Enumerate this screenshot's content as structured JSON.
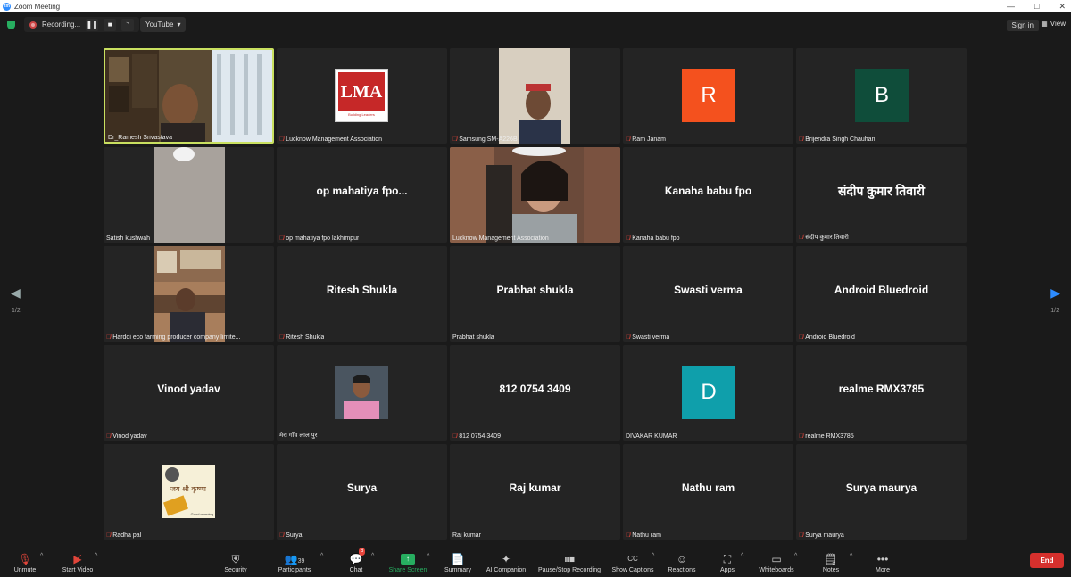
{
  "window": {
    "title": "Zoom Meeting",
    "controls": [
      "—",
      "□",
      "✕"
    ]
  },
  "topbar": {
    "recording_label": "Recording...",
    "youtube_label": "YouTube",
    "sign_in": "Sign in",
    "view": "View"
  },
  "page_indicator": "1/2",
  "tiles": [
    {
      "name": "Dr_Ramesh Srivastava",
      "center": "",
      "letter": "",
      "color": "",
      "muted": false
    },
    {
      "name": "Lucknow Management Association",
      "center": "",
      "letter": "",
      "color": "",
      "muted": true
    },
    {
      "name": "Samsung SM-A226B",
      "center": "",
      "letter": "",
      "color": "",
      "muted": true
    },
    {
      "name": "Ram Janam",
      "center": "",
      "letter": "R",
      "color": "#f4511e",
      "muted": true
    },
    {
      "name": "Brijendra Singh Chauhan",
      "center": "",
      "letter": "B",
      "color": "#0f4d3a",
      "muted": true
    },
    {
      "name": "Satish kushwah",
      "center": "",
      "letter": "",
      "color": "",
      "muted": false
    },
    {
      "name": "op mahatiya fpo lakhimpur",
      "center": "op mahatiya fpo...",
      "letter": "",
      "color": "",
      "muted": true
    },
    {
      "name": "Lucknow Management Association",
      "center": "",
      "letter": "",
      "color": "",
      "muted": false
    },
    {
      "name": "Kanaha babu fpo",
      "center": "Kanaha babu fpo",
      "letter": "",
      "color": "",
      "muted": true
    },
    {
      "name": "संदीप कुमार तिवारी",
      "center": "संदीप कुमार तिवारी",
      "letter": "",
      "color": "",
      "muted": true
    },
    {
      "name": "Hardoi eco farming producer company limite...",
      "center": "",
      "letter": "",
      "color": "",
      "muted": true
    },
    {
      "name": "Ritesh Shukla",
      "center": "Ritesh Shukla",
      "letter": "",
      "color": "",
      "muted": true
    },
    {
      "name": "Prabhat shukla",
      "center": "Prabhat shukla",
      "letter": "",
      "color": "",
      "muted": false
    },
    {
      "name": "Swasti verma",
      "center": "Swasti verma",
      "letter": "",
      "color": "",
      "muted": true
    },
    {
      "name": "Android Bluedroid",
      "center": "Android Bluedroid",
      "letter": "",
      "color": "",
      "muted": true
    },
    {
      "name": "Vinod yadav",
      "center": "Vinod yadav",
      "letter": "",
      "color": "",
      "muted": true
    },
    {
      "name": "मेरा गाँव लाल पुर",
      "center": "",
      "letter": "",
      "color": "",
      "muted": false
    },
    {
      "name": "812 0754 3409",
      "center": "812 0754 3409",
      "letter": "",
      "color": "",
      "muted": true
    },
    {
      "name": "DIVAKAR KUMAR",
      "center": "",
      "letter": "D",
      "color": "#0f9fab",
      "muted": false
    },
    {
      "name": "realme RMX3785",
      "center": "realme RMX3785",
      "letter": "",
      "color": "",
      "muted": true
    },
    {
      "name": "Radha pal",
      "center": "",
      "letter": "",
      "color": "",
      "muted": true
    },
    {
      "name": "Surya",
      "center": "Surya",
      "letter": "",
      "color": "",
      "muted": true
    },
    {
      "name": "Raj kumar",
      "center": "Raj kumar",
      "letter": "",
      "color": "",
      "muted": false
    },
    {
      "name": "Nathu ram",
      "center": "Nathu ram",
      "letter": "",
      "color": "",
      "muted": true
    },
    {
      "name": "Surya maurya",
      "center": "Surya maurya",
      "letter": "",
      "color": "",
      "muted": true
    }
  ],
  "logos": {
    "lma": "LMA",
    "lma_sub": "Building Leaders",
    "radha_text": "जय श्री कृष्णा",
    "radha_sub": "Good morning"
  },
  "toolbar": {
    "unmute": "Unmute",
    "start_video": "Start Video",
    "security": "Security",
    "participants": "Participants",
    "participants_count": "39",
    "chat": "Chat",
    "chat_badge": "6",
    "share_screen": "Share Screen",
    "summary": "Summary",
    "ai_companion": "AI Companion",
    "pause_stop_recording": "Pause/Stop Recording",
    "show_captions": "Show Captions",
    "reactions": "Reactions",
    "apps": "Apps",
    "whiteboards": "Whiteboards",
    "notes": "Notes",
    "more": "More",
    "end": "End"
  },
  "colors": {
    "accent": "#2d8cff",
    "end": "#d6302d",
    "share": "#27ae60",
    "active_border": "#c9e060"
  }
}
